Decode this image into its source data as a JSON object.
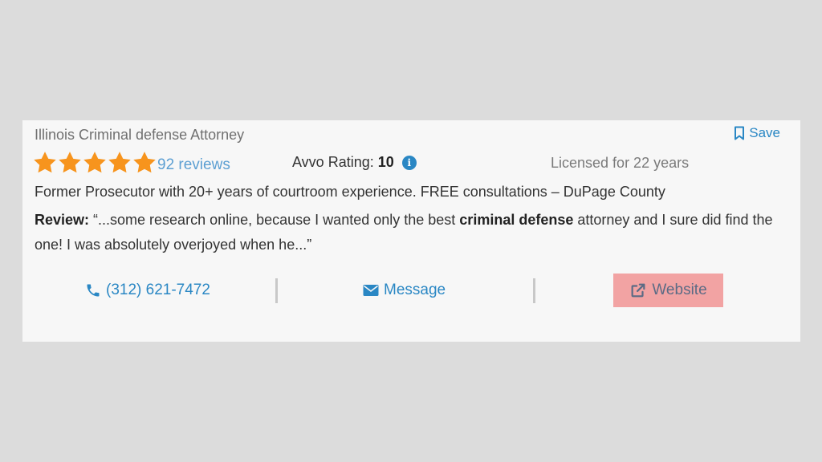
{
  "card": {
    "subtitle": "Illinois Criminal defense Attorney",
    "save_label": "Save",
    "rating_stars": 5,
    "reviews_label": "92 reviews",
    "avvo_rating_label": "Avvo Rating:",
    "avvo_rating_value": "10",
    "info_glyph": "i",
    "licensed_text": "Licensed for 22 years",
    "tagline": "Former Prosecutor with 20+ years of courtroom experience. FREE consultations – DuPage County",
    "review": {
      "label": "Review:",
      "text_before": " “...some research online, because I wanted only the best ",
      "highlight": "criminal defense",
      "text_after": " attorney and I sure did find the one! I was absolutely overjoyed when he...”"
    }
  },
  "actions": {
    "phone_label": "(312) 621-7472",
    "message_label": "Message",
    "website_label": "Website"
  },
  "colors": {
    "accent": "#2a87c4",
    "star": "#f7941d",
    "website_highlight": "#f2a3a3",
    "page_bg": "#dcdcdc",
    "card_bg": "#f7f7f7"
  },
  "icons": {
    "save": "bookmark-icon",
    "star": "star-icon",
    "info": "info-icon",
    "phone": "phone-icon",
    "message": "envelope-icon",
    "website": "external-link-icon"
  }
}
